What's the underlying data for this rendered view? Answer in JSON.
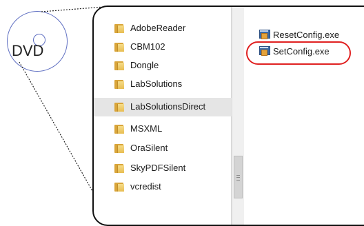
{
  "disc": {
    "label": "DVD",
    "icon": "dvd-disc-icon"
  },
  "folders": [
    {
      "label": "AdobeReader",
      "selected": false
    },
    {
      "label": "CBM102",
      "selected": false
    },
    {
      "label": "Dongle",
      "selected": false
    },
    {
      "label": "LabSolutions",
      "selected": false
    },
    {
      "label": "LabSolutionsDirect",
      "selected": true
    },
    {
      "label": "MSXML",
      "selected": false
    },
    {
      "label": "OraSilent",
      "selected": false
    },
    {
      "label": "SkyPDFSilent",
      "selected": false
    },
    {
      "label": "vcredist",
      "selected": false
    }
  ],
  "files": [
    {
      "label": "ResetConfig.exe",
      "icon": "exe-file-icon",
      "highlighted": false
    },
    {
      "label": "SetConfig.exe",
      "icon": "exe-file-icon",
      "highlighted": true
    }
  ],
  "colors": {
    "highlight": "#e02020",
    "disc_outline": "#5f6fc2",
    "folder": "#e8bd52",
    "selection": "#e5e5e5"
  }
}
